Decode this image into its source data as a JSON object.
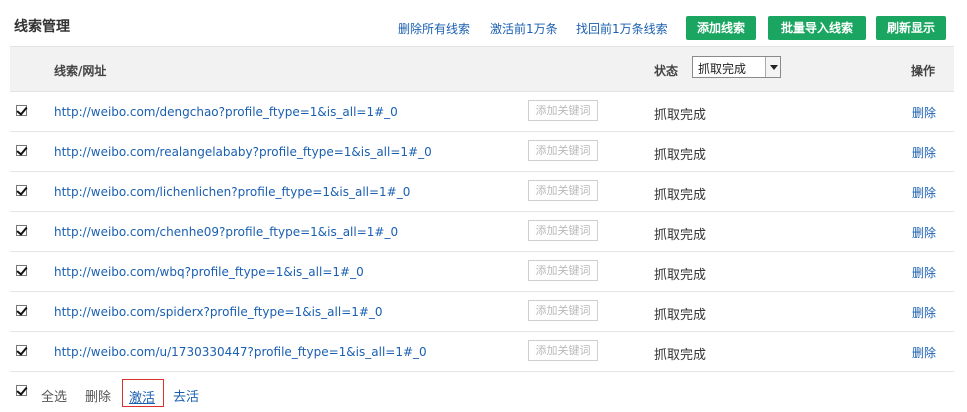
{
  "header": {
    "title": "线索管理",
    "links": [
      "删除所有线索",
      "激活前1万条",
      "找回前1万条线索"
    ],
    "buttons": [
      "添加线索",
      "批量导入线索",
      "刷新显示"
    ]
  },
  "table": {
    "col_url": "线索/网址",
    "col_status": "状态",
    "status_filter_value": "抓取完成",
    "col_action": "操作",
    "keyword_button_label": "添加关键词",
    "delete_label": "删除",
    "rows": [
      {
        "url": "http://weibo.com/dengchao?profile_ftype=1&is_all=1#_0",
        "status": "抓取完成",
        "checked": true
      },
      {
        "url": "http://weibo.com/realangelababy?profile_ftype=1&is_all=1#_0",
        "status": "抓取完成",
        "checked": true
      },
      {
        "url": "http://weibo.com/lichenlichen?profile_ftype=1&is_all=1#_0",
        "status": "抓取完成",
        "checked": true
      },
      {
        "url": "http://weibo.com/chenhe09?profile_ftype=1&is_all=1#_0",
        "status": "抓取完成",
        "checked": true
      },
      {
        "url": "http://weibo.com/wbq?profile_ftype=1&is_all=1#_0",
        "status": "抓取完成",
        "checked": true
      },
      {
        "url": "http://weibo.com/spiderx?profile_ftype=1&is_all=1#_0",
        "status": "抓取完成",
        "checked": true
      },
      {
        "url": "http://weibo.com/u/1730330447?profile_ftype=1&is_all=1#_0",
        "status": "抓取完成",
        "checked": true
      }
    ]
  },
  "footer": {
    "select_all": "全选",
    "delete": "删除",
    "activate": "激活",
    "deactivate": "去活"
  },
  "colors": {
    "accent_green": "#1aa660",
    "link_blue": "#1a5fb0",
    "highlight_red": "#d9322b"
  }
}
